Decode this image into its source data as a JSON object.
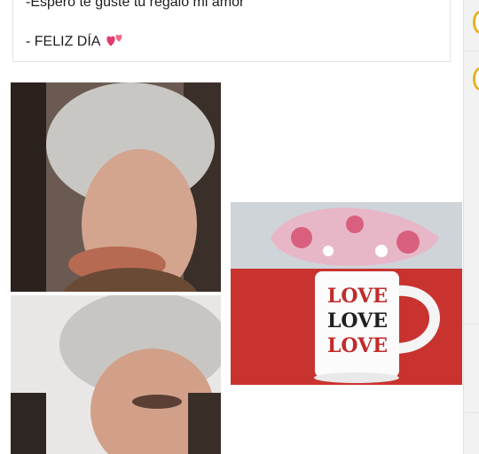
{
  "post": {
    "line1": "-Espero te guste tu regalo mi amor",
    "line2": "- FELIZ DÍA",
    "heart_icon": "two-hearts-emoji"
  },
  "mug_photo": {
    "mug_words": [
      "LOVE",
      "LOVE",
      "LOVE"
    ]
  },
  "colors": {
    "accent_gold": "#e6b21e",
    "table_red": "#c8332f",
    "text": "#1c1c1c"
  }
}
